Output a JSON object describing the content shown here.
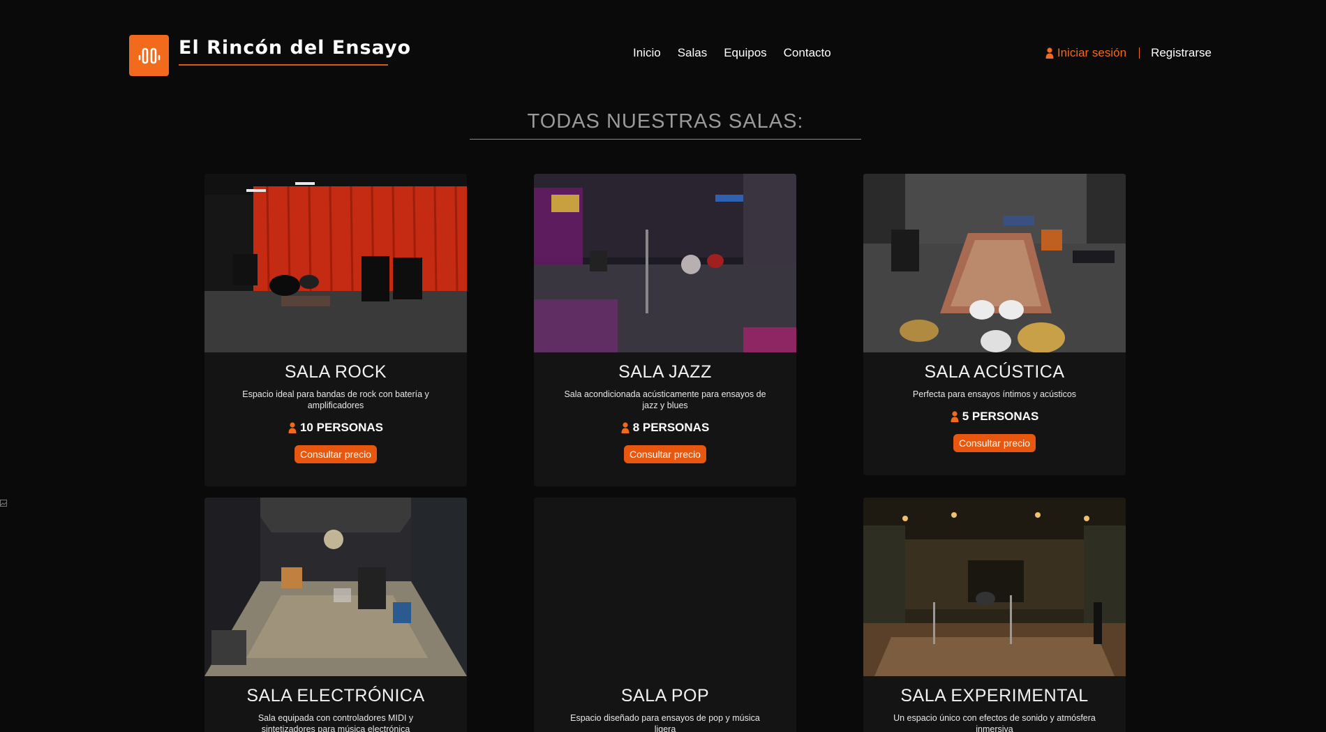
{
  "brand": {
    "name": "El Rincón del Ensayo",
    "accent": "#f26a1b",
    "icon": "waveform-icon"
  },
  "nav": [
    {
      "label": "Inicio"
    },
    {
      "label": "Salas"
    },
    {
      "label": "Equipos"
    },
    {
      "label": "Contacto"
    }
  ],
  "auth": {
    "login_label": "Iniciar sesión",
    "login_icon": "user-icon",
    "register_label": "Registrarse"
  },
  "section": {
    "title": "TODAS NUESTRAS SALAS:"
  },
  "rooms": [
    {
      "name": "SALA ROCK",
      "description": "Espacio ideal para bandas de rock con batería y amplificadores",
      "capacity": "10 PERSONAS",
      "button": "Consultar precio",
      "has_image": true
    },
    {
      "name": "SALA JAZZ",
      "description": "Sala acondicionada acústicamente para ensayos de jazz y blues",
      "capacity": "8 PERSONAS",
      "button": "Consultar precio",
      "has_image": true
    },
    {
      "name": "SALA ACÚSTICA",
      "description": "Perfecta para ensayos íntimos y acústicos",
      "capacity": "5 PERSONAS",
      "button": "Consultar precio",
      "has_image": true
    },
    {
      "name": "SALA ELECTRÓNICA",
      "description": "Sala equipada con controladores MIDI y sintetizadores para música electrónica",
      "has_image": true
    },
    {
      "name": "SALA POP",
      "description": "Espacio diseñado para ensayos de pop y música ligera",
      "has_image": false
    },
    {
      "name": "SALA EXPERIMENTAL",
      "description": "Un espacio único con efectos de sonido y atmósfera inmersiva",
      "has_image": true
    }
  ]
}
